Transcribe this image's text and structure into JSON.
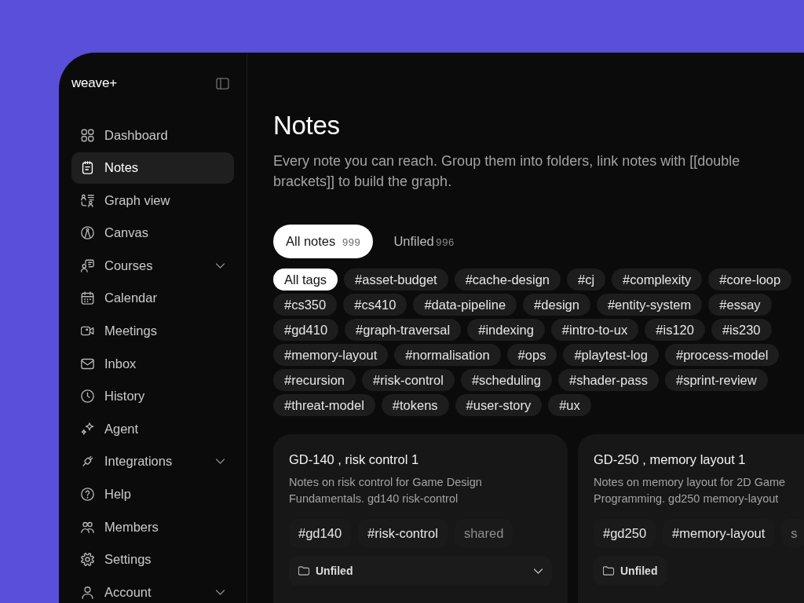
{
  "app": {
    "logo": "weave+"
  },
  "sidebar": {
    "items": [
      {
        "kind": "dashboard",
        "label": "Dashboard",
        "selected": false,
        "has_submenu": false
      },
      {
        "kind": "notes",
        "label": "Notes",
        "selected": true,
        "has_submenu": false
      },
      {
        "kind": "graph",
        "label": "Graph view",
        "selected": false,
        "has_submenu": false
      },
      {
        "kind": "canvas",
        "label": "Canvas",
        "selected": false,
        "has_submenu": false
      },
      {
        "kind": "courses",
        "label": "Courses",
        "selected": false,
        "has_submenu": true
      },
      {
        "kind": "calendar",
        "label": "Calendar",
        "selected": false,
        "has_submenu": false
      },
      {
        "kind": "meetings",
        "label": "Meetings",
        "selected": false,
        "has_submenu": false
      },
      {
        "kind": "inbox",
        "label": "Inbox",
        "selected": false,
        "has_submenu": false
      },
      {
        "kind": "history",
        "label": "History",
        "selected": false,
        "has_submenu": false
      },
      {
        "kind": "agent",
        "label": "Agent",
        "selected": false,
        "has_submenu": false
      },
      {
        "kind": "integrations",
        "label": "Integrations",
        "selected": false,
        "has_submenu": true
      },
      {
        "kind": "help",
        "label": "Help",
        "selected": false,
        "has_submenu": false
      },
      {
        "kind": "members",
        "label": "Members",
        "selected": false,
        "has_submenu": false
      },
      {
        "kind": "settings",
        "label": "Settings",
        "selected": false,
        "has_submenu": false
      },
      {
        "kind": "account",
        "label": "Account",
        "selected": false,
        "has_submenu": true
      }
    ]
  },
  "header": {
    "title": "Notes",
    "description": "Every note you can reach. Group them into folders, link notes with [[double brackets]] to build the graph."
  },
  "tabs": [
    {
      "label": "All notes",
      "count": "999",
      "selected": true
    },
    {
      "label": "Unfiled",
      "count": "996",
      "selected": false
    }
  ],
  "tag_filter": {
    "rows": [
      [
        {
          "label": "All tags",
          "selected": true
        },
        {
          "label": "#asset-budget",
          "selected": false
        },
        {
          "label": "#cache-design",
          "selected": false
        },
        {
          "label": "#cj",
          "selected": false
        },
        {
          "label": "#complexity",
          "selected": false
        },
        {
          "label": "#core-loop",
          "selected": false
        }
      ],
      [
        {
          "label": "#cs350",
          "selected": false
        },
        {
          "label": "#cs410",
          "selected": false
        },
        {
          "label": "#data-pipeline",
          "selected": false
        },
        {
          "label": "#design",
          "selected": false
        },
        {
          "label": "#entity-system",
          "selected": false
        },
        {
          "label": "#essay",
          "selected": false
        }
      ],
      [
        {
          "label": "#gd410",
          "selected": false
        },
        {
          "label": "#graph-traversal",
          "selected": false
        },
        {
          "label": "#indexing",
          "selected": false
        },
        {
          "label": "#intro-to-ux",
          "selected": false
        },
        {
          "label": "#is120",
          "selected": false
        },
        {
          "label": "#is230",
          "selected": false
        }
      ],
      [
        {
          "label": "#memory-layout",
          "selected": false
        },
        {
          "label": "#normalisation",
          "selected": false
        },
        {
          "label": "#ops",
          "selected": false
        },
        {
          "label": "#playtest-log",
          "selected": false
        },
        {
          "label": "#process-model",
          "selected": false
        }
      ],
      [
        {
          "label": "#recursion",
          "selected": false
        },
        {
          "label": "#risk-control",
          "selected": false
        },
        {
          "label": "#scheduling",
          "selected": false
        },
        {
          "label": "#shader-pass",
          "selected": false
        },
        {
          "label": "#sprint-review",
          "selected": false
        }
      ],
      [
        {
          "label": "#threat-model",
          "selected": false
        },
        {
          "label": "#tokens",
          "selected": false
        },
        {
          "label": "#user-story",
          "selected": false
        },
        {
          "label": "#ux",
          "selected": false
        }
      ]
    ]
  },
  "cards": [
    {
      "title": "GD-140 , risk control 1",
      "description": "Notes on risk control for Game Design Fundamentals. gd140 risk-control",
      "chips": [
        {
          "kind": "tag",
          "label": "#gd140"
        },
        {
          "kind": "tag",
          "label": "#risk-control"
        },
        {
          "kind": "visibility",
          "label": "shared"
        }
      ],
      "folder": {
        "label": "Unfiled",
        "dropdown": true
      }
    },
    {
      "title": "GD-250 , memory layout 1",
      "description": "Notes on memory layout for 2D Game Programming. gd250 memory-layout",
      "chips": [
        {
          "kind": "tag",
          "label": "#gd250"
        },
        {
          "kind": "tag",
          "label": "#memory-layout"
        },
        {
          "kind": "visibility",
          "label": "s"
        }
      ],
      "folder": {
        "label": "Unfiled",
        "dropdown": false
      }
    }
  ]
}
